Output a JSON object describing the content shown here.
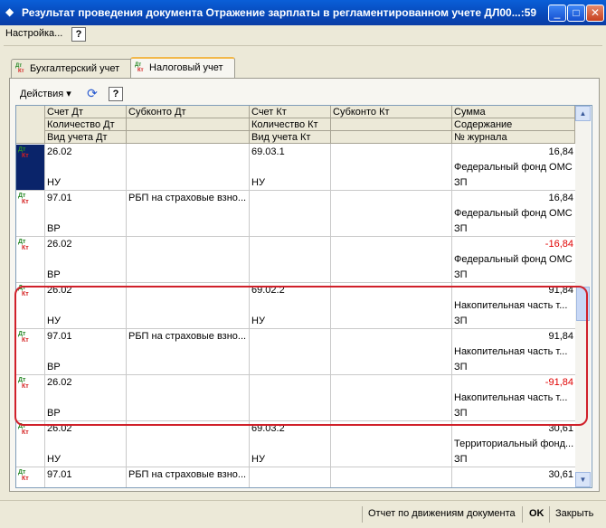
{
  "window": {
    "title": "Результат проведения документа Отражение зарплаты в регламентированном учете ДЛ00...:59",
    "buttons": {
      "minimize": "_",
      "maximize": "□",
      "close": "✕"
    }
  },
  "menu": {
    "settings": "Настройка...",
    "help": "?"
  },
  "tabs": [
    {
      "label": "Бухгалтерский учет"
    },
    {
      "label": "Налоговый учет"
    }
  ],
  "icons": {
    "dt": "Дт",
    "kt": "Кт"
  },
  "toolbar": {
    "actions": "Действия",
    "help": "?"
  },
  "columns": {
    "row1": [
      "Счет Дт",
      "Субконто Дт",
      "Счет Кт",
      "Субконто Кт",
      "Сумма"
    ],
    "row2": [
      "Количество Дт",
      "",
      "Количество Кт",
      "",
      "Содержание"
    ],
    "row3": [
      "Вид учета Дт",
      "",
      "Вид учета Кт",
      "",
      "№ журнала"
    ]
  },
  "rows": [
    {
      "schet_dt": "26.02",
      "subkonto_dt": "",
      "schet_kt": "69.03.1",
      "subkonto_kt": "",
      "summa": "16,84",
      "negative": false,
      "soderzhanie": "Федеральный фонд ОМС",
      "vid_dt": "НУ",
      "vid_kt": "НУ",
      "zhurnal": "ЗП"
    },
    {
      "schet_dt": "97.01",
      "subkonto_dt": "РБП на страховые взно...",
      "schet_kt": "",
      "subkonto_kt": "",
      "summa": "16,84",
      "negative": false,
      "soderzhanie": "Федеральный фонд ОМС",
      "vid_dt": "ВР",
      "vid_kt": "",
      "zhurnal": "ЗП"
    },
    {
      "schet_dt": "26.02",
      "subkonto_dt": "",
      "schet_kt": "",
      "subkonto_kt": "",
      "summa": "-16,84",
      "negative": true,
      "soderzhanie": "Федеральный фонд ОМС",
      "vid_dt": "ВР",
      "vid_kt": "",
      "zhurnal": "ЗП"
    },
    {
      "schet_dt": "26.02",
      "subkonto_dt": "",
      "schet_kt": "69.02.2",
      "subkonto_kt": "",
      "summa": "91,84",
      "negative": false,
      "soderzhanie": "Накопительная часть т...",
      "vid_dt": "НУ",
      "vid_kt": "НУ",
      "zhurnal": "ЗП"
    },
    {
      "schet_dt": "97.01",
      "subkonto_dt": "РБП на страховые взно...",
      "schet_kt": "",
      "subkonto_kt": "",
      "summa": "91,84",
      "negative": false,
      "soderzhanie": "Накопительная часть т...",
      "vid_dt": "ВР",
      "vid_kt": "",
      "zhurnal": "ЗП"
    },
    {
      "schet_dt": "26.02",
      "subkonto_dt": "",
      "schet_kt": "",
      "subkonto_kt": "",
      "summa": "-91,84",
      "negative": true,
      "soderzhanie": "Накопительная часть т...",
      "vid_dt": "ВР",
      "vid_kt": "",
      "zhurnal": "ЗП"
    },
    {
      "schet_dt": "26.02",
      "subkonto_dt": "",
      "schet_kt": "69.03.2",
      "subkonto_kt": "",
      "summa": "30,61",
      "negative": false,
      "soderzhanie": "Территориальный фонд...",
      "vid_dt": "НУ",
      "vid_kt": "НУ",
      "zhurnal": "ЗП"
    },
    {
      "schet_dt": "97.01",
      "subkonto_dt": "РБП на страховые взно...",
      "schet_kt": "",
      "subkonto_kt": "",
      "summa": "30,61",
      "negative": false,
      "soderzhanie": "",
      "vid_dt": "",
      "vid_kt": "",
      "zhurnal": ""
    }
  ],
  "bottom": {
    "report": "Отчет по движениям документа",
    "ok": "OK",
    "close": "Закрыть"
  },
  "colors": {
    "highlight": "#d0202a",
    "negative": "#e00000",
    "title_bar": "#0a5fd8"
  }
}
